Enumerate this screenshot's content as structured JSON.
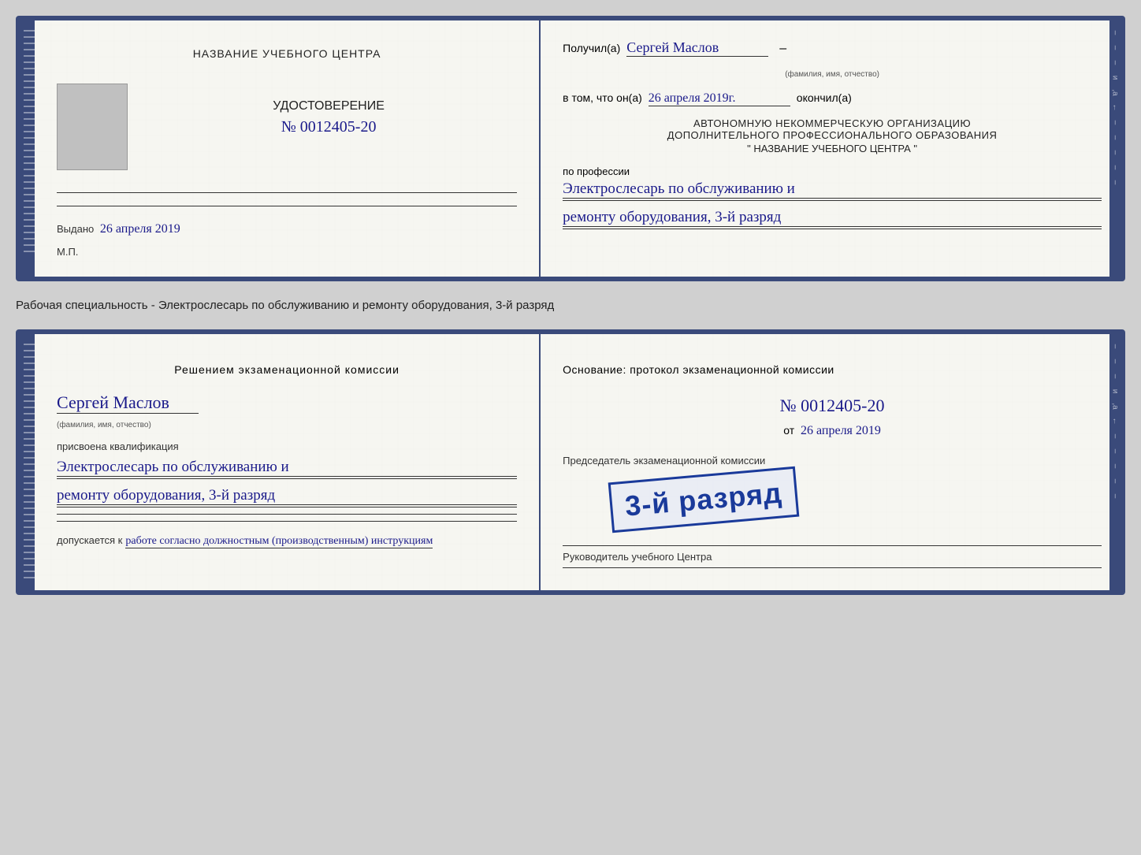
{
  "doc1": {
    "left": {
      "training_center_label": "НАЗВАНИЕ УЧЕБНОГО ЦЕНТРА",
      "certificate_label": "УДОСТОВЕРЕНИЕ",
      "number_label": "№ 0012405-20",
      "issued_label": "Выдано",
      "issued_date": "26 апреля 2019",
      "mp_label": "М.П."
    },
    "right": {
      "received_label": "Получил(а)",
      "name_handwritten": "Сергей Маслов",
      "name_sublabel": "(фамилия, имя, отчество)",
      "dash": "–",
      "in_that_label": "в том, что он(а)",
      "date_handwritten": "26 апреля 2019г.",
      "finished_label": "окончил(а)",
      "org_line1": "АВТОНОМНУЮ НЕКОММЕРЧЕСКУЮ ОРГАНИЗАЦИЮ",
      "org_line2": "ДОПОЛНИТЕЛЬНОГО ПРОФЕССИОНАЛЬНОГО ОБРАЗОВАНИЯ",
      "org_name": "\" НАЗВАНИЕ УЧЕБНОГО ЦЕНТРА \"",
      "profession_label": "по профессии",
      "profession_handwritten_1": "Электрослесарь по обслуживанию и",
      "profession_handwritten_2": "ремонту оборудования, 3-й разряд"
    }
  },
  "between_label": "Рабочая специальность - Электрослесарь по обслуживанию и ремонту оборудования, 3-й разряд",
  "doc2": {
    "left": {
      "decision_label": "Решением экзаменационной комиссии",
      "name_handwritten": "Сергей Маслов",
      "name_sublabel": "(фамилия, имя, отчество)",
      "assigned_label": "присвоена квалификация",
      "qualification_1": "Электрослесарь по обслуживанию и",
      "qualification_2": "ремонту оборудования, 3-й разряд",
      "allowed_label": "допускается к",
      "allowed_handwritten": "работе согласно должностным (производственным) инструкциям"
    },
    "right": {
      "basis_label": "Основание: протокол экзаменационной комиссии",
      "number_label": "№ 0012405-20",
      "date_prefix": "от",
      "date_value": "26 апреля 2019",
      "chairman_label": "Председатель экзаменационной комиссии",
      "stamp_text": "3-й разряд",
      "director_label": "Руководитель учебного Центра"
    }
  },
  "side_dashes": [
    "–",
    "–",
    "–",
    "и",
    ",а",
    "←",
    "–",
    "–",
    "–",
    "–",
    "–"
  ],
  "colors": {
    "spine": "#3a4a7a",
    "handwriting": "#1a1a8a",
    "stamp_border": "#1a3a9a"
  }
}
